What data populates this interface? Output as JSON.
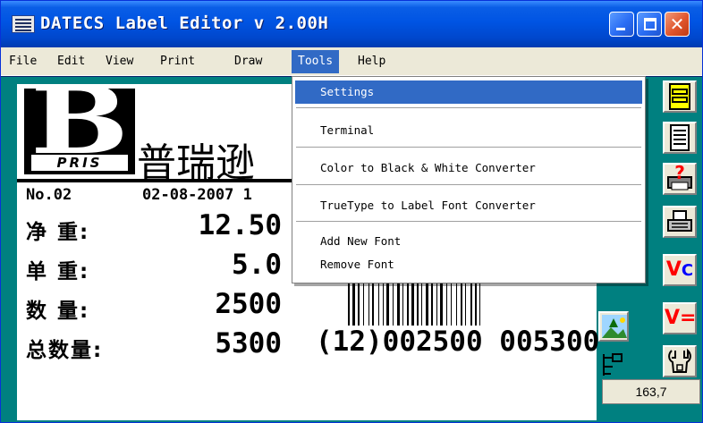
{
  "window": {
    "title": "DATECS Label Editor v 2.00H"
  },
  "menu": [
    "File",
    "Edit",
    "View",
    "Print",
    "Draw",
    "Tools",
    "Help"
  ],
  "active_menu": "Tools",
  "tools_menu": {
    "items": [
      "Settings",
      "Terminal",
      "Color to Black & White Converter",
      "TrueType to Label Font Converter",
      "Add New Font",
      "Remove Font"
    ],
    "highlighted": "Settings"
  },
  "label": {
    "logo_letter": "B",
    "logo_sub": "PRIS",
    "brand_chinese": "普瑞逊",
    "no": "No.02",
    "date": "02-08-2007 1",
    "rows": [
      {
        "label": "净  重:",
        "value": "12.50"
      },
      {
        "label": "单  重:",
        "value": "5.0"
      },
      {
        "label": "数  量:",
        "value": "2500"
      },
      {
        "label": "总数量:",
        "value": "5300"
      }
    ],
    "barcode_text": "(12)002500  005300"
  },
  "toolbar": {
    "colors": {
      "yellow": "#ffff00",
      "red": "#ff0000",
      "blue": "#0000ff"
    },
    "icons": [
      "form-icon",
      "document-list-icon",
      "print-help-icon",
      "printer-icon",
      "var-counter-icon",
      "picture-icon",
      "var-equal-icon",
      "tree-layout-icon",
      "wrench-icon"
    ],
    "vc_label": "V",
    "vc_sub": "C",
    "veq_label": "V=",
    "coord_readout": "163,7"
  }
}
